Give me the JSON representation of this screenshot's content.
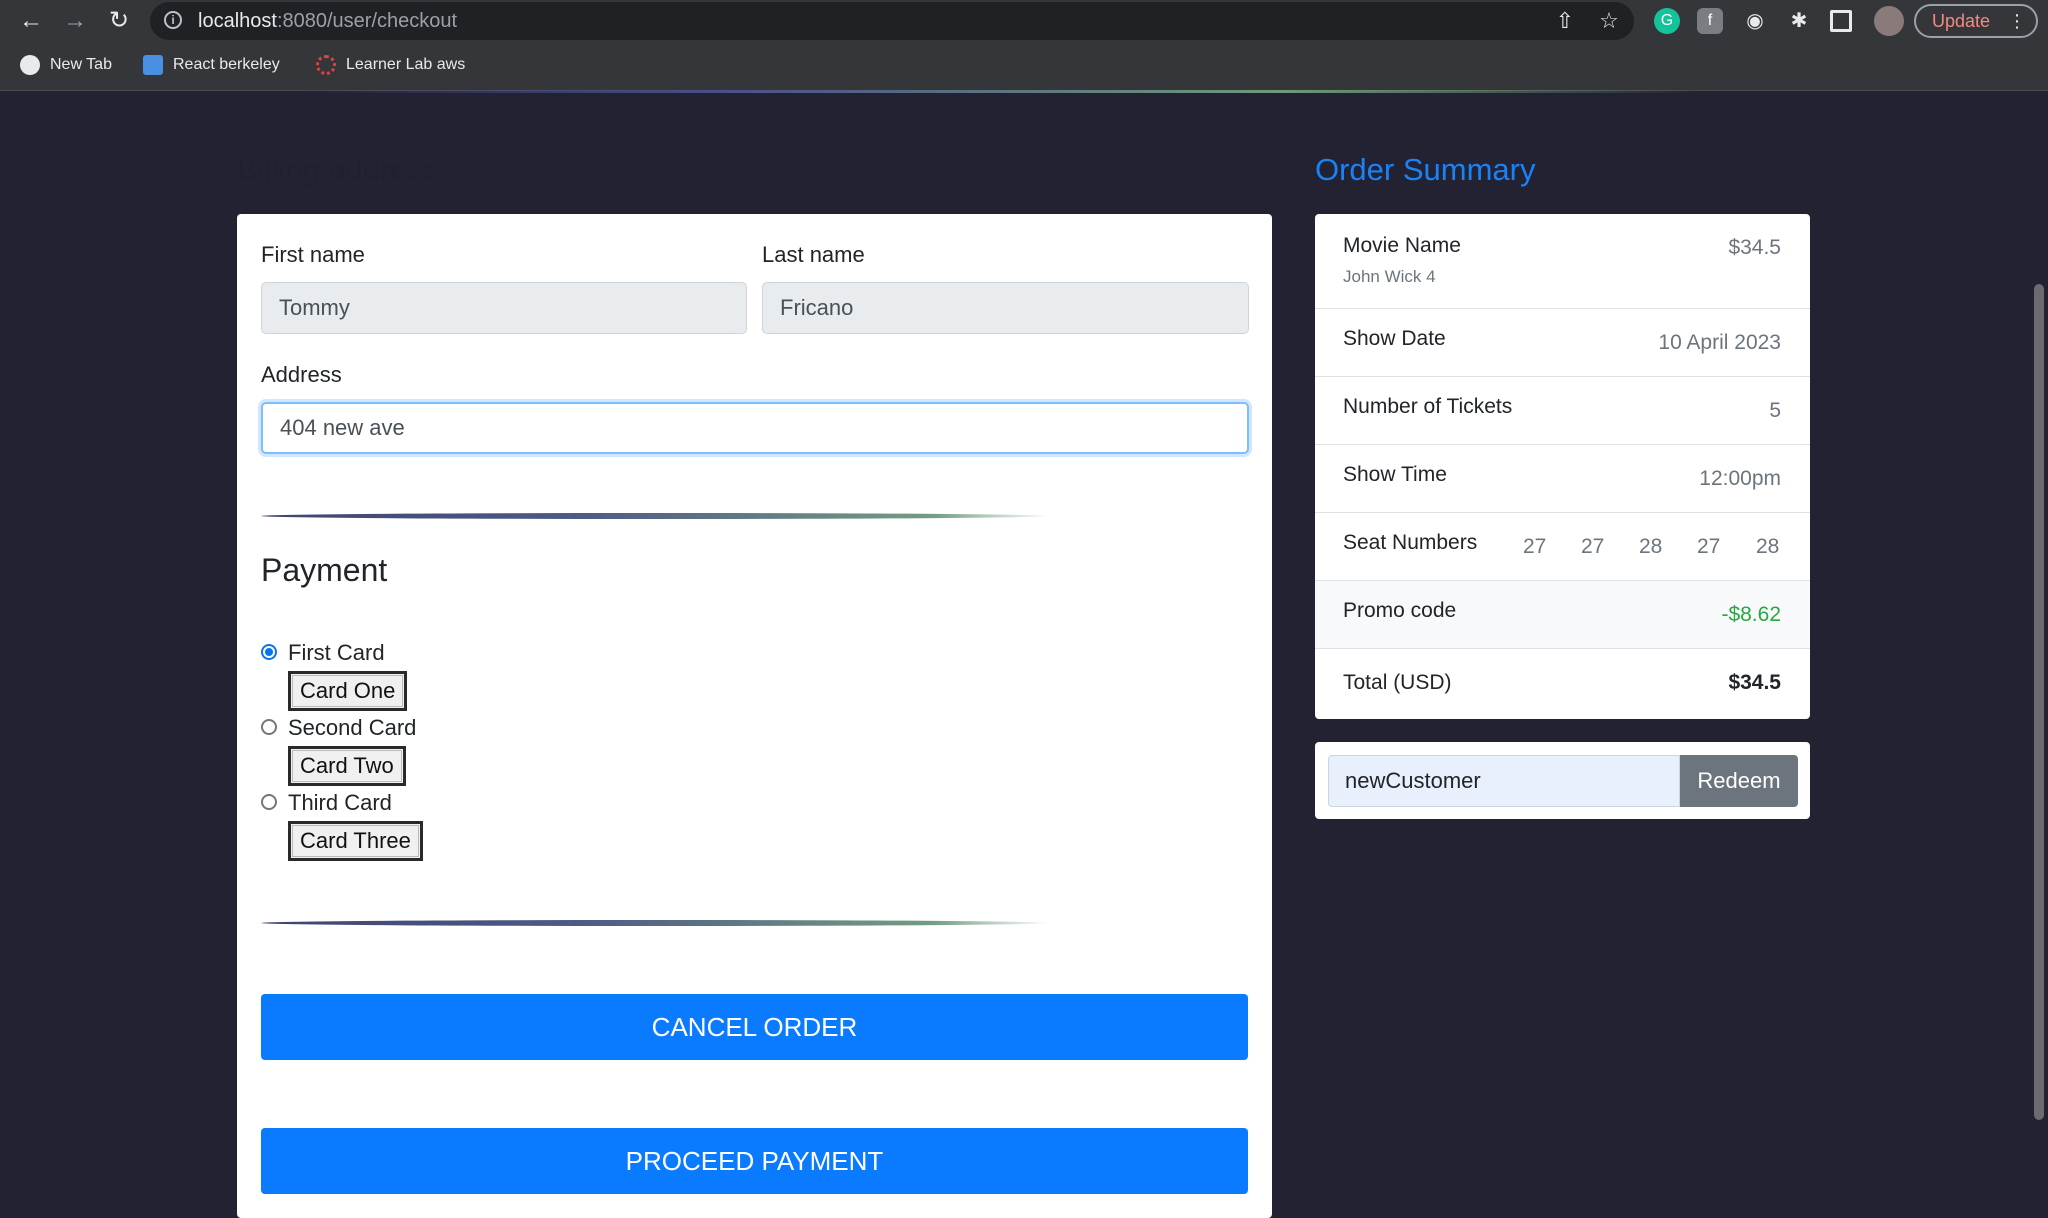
{
  "browser": {
    "url_host": "localhost",
    "url_path": ":8080/user/checkout",
    "update_label": "Update",
    "bookmarks": [
      {
        "label": "New Tab"
      },
      {
        "label": "React berkeley"
      },
      {
        "label": "Learner Lab aws"
      }
    ]
  },
  "billing": {
    "title": "Billing address",
    "first_name_label": "First name",
    "first_name_value": "Tommy",
    "last_name_label": "Last name",
    "last_name_value": "Fricano",
    "address_label": "Address",
    "address_value": "404 new ave"
  },
  "payment": {
    "title": "Payment",
    "options": [
      {
        "label": "First Card",
        "button": "Card One",
        "checked": true
      },
      {
        "label": "Second Card",
        "button": "Card Two",
        "checked": false
      },
      {
        "label": "Third Card",
        "button": "Card Three",
        "checked": false
      }
    ],
    "cancel_label": "CANCEL ORDER",
    "proceed_label": "PROCEED PAYMENT"
  },
  "summary": {
    "title": "Order Summary",
    "movie_label": "Movie Name",
    "movie_name": "John Wick 4",
    "movie_price": "$34.5",
    "show_date_label": "Show Date",
    "show_date": "10 April 2023",
    "tickets_label": "Number of Tickets",
    "tickets": "5",
    "show_time_label": "Show Time",
    "show_time": "12:00pm",
    "seats_label": "Seat Numbers",
    "seats": [
      "27",
      "27",
      "28",
      "27",
      "28"
    ],
    "promo_label": "Promo code",
    "promo_value": "-$8.62",
    "total_label": "Total (USD)",
    "total_value": "$34.5"
  },
  "redeem": {
    "code": "newCustomer",
    "button_label": "Redeem"
  },
  "colors": {
    "page_bg": "#222233",
    "accent_blue": "#1a82f7",
    "primary_button": "#0a7bff",
    "promo_green": "#28a745"
  }
}
